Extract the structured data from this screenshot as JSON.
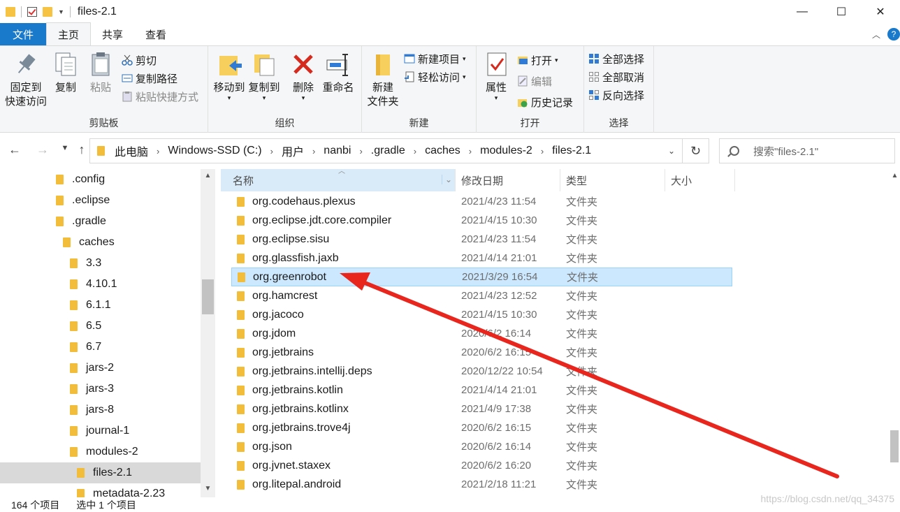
{
  "window": {
    "title": "files-2.1"
  },
  "tabs": [
    "文件",
    "主页",
    "共享",
    "查看"
  ],
  "ribbon": {
    "clipboard": {
      "label": "剪贴板",
      "pin": "固定到\n快速访问",
      "copy": "复制",
      "paste": "粘贴",
      "cut": "剪切",
      "copy_path": "复制路径",
      "paste_shortcut": "粘贴快捷方式"
    },
    "organize": {
      "label": "组织",
      "move_to": "移动到",
      "copy_to": "复制到",
      "delete": "删除",
      "rename": "重命名"
    },
    "new": {
      "label": "新建",
      "new_folder": "新建\n文件夹",
      "new_item": "新建项目",
      "easy_access": "轻松访问"
    },
    "open": {
      "label": "打开",
      "properties": "属性",
      "open": "打开",
      "edit": "编辑",
      "history": "历史记录"
    },
    "select": {
      "label": "选择",
      "select_all": "全部选择",
      "select_none": "全部取消",
      "invert": "反向选择"
    }
  },
  "address": {
    "crumbs": [
      "此电脑",
      "Windows-SSD (C:)",
      "用户",
      "nanbi",
      ".gradle",
      "caches",
      "modules-2",
      "files-2.1"
    ],
    "search_placeholder": "搜索\"files-2.1\""
  },
  "tree": [
    {
      "label": ".config",
      "level": 0
    },
    {
      "label": ".eclipse",
      "level": 0
    },
    {
      "label": ".gradle",
      "level": 0
    },
    {
      "label": "caches",
      "level": 1
    },
    {
      "label": "3.3",
      "level": 2
    },
    {
      "label": "4.10.1",
      "level": 2
    },
    {
      "label": "6.1.1",
      "level": 2
    },
    {
      "label": "6.5",
      "level": 2
    },
    {
      "label": "6.7",
      "level": 2
    },
    {
      "label": "jars-2",
      "level": 2
    },
    {
      "label": "jars-3",
      "level": 2
    },
    {
      "label": "jars-8",
      "level": 2
    },
    {
      "label": "journal-1",
      "level": 2
    },
    {
      "label": "modules-2",
      "level": 2
    },
    {
      "label": "files-2.1",
      "level": 3,
      "selected": true
    },
    {
      "label": "metadata-2.23",
      "level": 3
    }
  ],
  "columns": {
    "name": "名称",
    "date": "修改日期",
    "type": "类型",
    "size": "大小"
  },
  "files": [
    {
      "name": "org.codehaus.plexus",
      "date": "2021/4/23 11:54",
      "type": "文件夹"
    },
    {
      "name": "org.eclipse.jdt.core.compiler",
      "date": "2021/4/15 10:30",
      "type": "文件夹"
    },
    {
      "name": "org.eclipse.sisu",
      "date": "2021/4/23 11:54",
      "type": "文件夹"
    },
    {
      "name": "org.glassfish.jaxb",
      "date": "2021/4/14 21:01",
      "type": "文件夹"
    },
    {
      "name": "org.greenrobot",
      "date": "2021/3/29 16:54",
      "type": "文件夹",
      "selected": true
    },
    {
      "name": "org.hamcrest",
      "date": "2021/4/23 12:52",
      "type": "文件夹"
    },
    {
      "name": "org.jacoco",
      "date": "2021/4/15 10:30",
      "type": "文件夹"
    },
    {
      "name": "org.jdom",
      "date": "2020/6/2 16:14",
      "type": "文件夹"
    },
    {
      "name": "org.jetbrains",
      "date": "2020/6/2 16:15",
      "type": "文件夹"
    },
    {
      "name": "org.jetbrains.intellij.deps",
      "date": "2020/12/22 10:54",
      "type": "文件夹"
    },
    {
      "name": "org.jetbrains.kotlin",
      "date": "2021/4/14 21:01",
      "type": "文件夹"
    },
    {
      "name": "org.jetbrains.kotlinx",
      "date": "2021/4/9 17:38",
      "type": "文件夹"
    },
    {
      "name": "org.jetbrains.trove4j",
      "date": "2020/6/2 16:15",
      "type": "文件夹"
    },
    {
      "name": "org.json",
      "date": "2020/6/2 16:14",
      "type": "文件夹"
    },
    {
      "name": "org.jvnet.staxex",
      "date": "2020/6/2 16:20",
      "type": "文件夹"
    },
    {
      "name": "org.litepal.android",
      "date": "2021/2/18 11:21",
      "type": "文件夹"
    }
  ],
  "status": {
    "count": "164 个项目",
    "selected": "选中 1 个项目"
  },
  "watermark": "https://blog.csdn.net/qq_34375",
  "colors": {
    "accent": "#1979ca",
    "selection": "#cce8ff",
    "arrow": "#e8261d",
    "folder": "#f3bd3c"
  }
}
